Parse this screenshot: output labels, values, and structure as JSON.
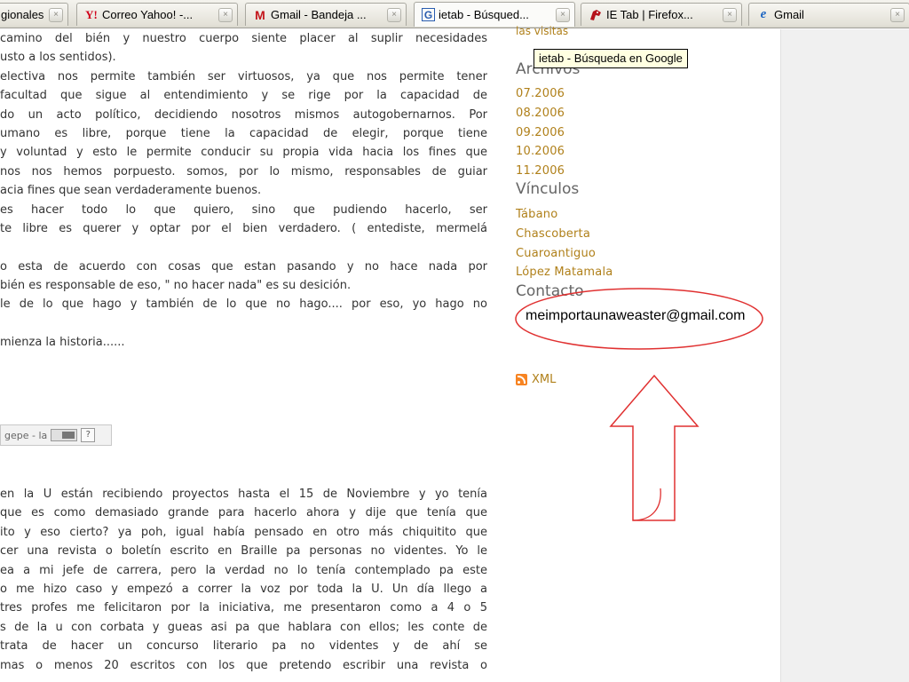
{
  "tabs": [
    {
      "label": "gionales",
      "icon": "tab-page-icon"
    },
    {
      "label": "Correo Yahoo! -...",
      "icon": "yahoo-icon"
    },
    {
      "label": "Gmail - Bandeja ...",
      "icon": "gmail-icon"
    },
    {
      "label": "ietab - Búsqued...",
      "icon": "google-icon",
      "active": true
    },
    {
      "label": "IE Tab | Firefox...",
      "icon": "ietab-icon"
    },
    {
      "label": "Gmail",
      "icon": "ie-icon"
    }
  ],
  "tab_close_glyph": "×",
  "tooltip": "ietab - Búsqueda en Google",
  "main": {
    "lines": [
      "camino del bién y nuestro cuerpo siente placer al suplir necesidades",
      "usto a los sentidos).",
      "electiva nos permite también ser virtuosos, ya que nos permite tener",
      "facultad que sigue al entendimiento y se rige por la capacidad de",
      "do un acto político, decidiendo nosotros mismos autogobernarnos. Por",
      "umano es libre, porque tiene la capacidad de elegir, porque tiene",
      "y voluntad y esto le permite conducir su propia vida hacia los fines que",
      "nos nos hemos porpuesto. somos, por lo mismo, responsables de guiar",
      "acia fines que sean verdaderamente buenos.",
      "es hacer todo lo que quiero, sino que pudiendo hacerlo, ser",
      "te libre es querer y optar por el bien verdadero. ( entediste, mermelá",
      "",
      "o esta de acuerdo con cosas que estan pasando y no hace nada por",
      "bién es responsable de eso, \" no hacer nada\" es su desición.",
      "le de lo que hago y también de lo que no hago.... por eso, yo hago no",
      "",
      "mienza la historia......"
    ],
    "widget_text": "gepe - la",
    "widget_help": "?",
    "lines2": [
      "en la U están recibiendo proyectos hasta el 15 de Noviembre y yo tenía",
      "que es como demasiado grande para hacerlo ahora y dije que tenía que",
      "ito y eso cierto? ya poh, igual había pensado en otro más chiquitito que",
      "cer una revista o boletín escrito en Braille pa personas no videntes. Yo le",
      "ea a mi jefe de carrera, pero la verdad no lo tenía contemplado pa este",
      "o me hizo caso y empezó a correr la voz por toda la U. Un día llego a",
      "tres profes me felicitaron por la iniciativa, me presentaron como a 4 o 5",
      "s de la u con corbata y gueas asi pa que hablara con ellos; les conte de",
      "trata de hacer un concurso literario pa no videntes y de ahí se",
      "mas o menos 20 escritos con los que pretendo escribir una revista o"
    ]
  },
  "sidebar": {
    "faint_top": "las visitas",
    "archive_heading": "Archivos",
    "archives": [
      "07.2006",
      "08.2006",
      "09.2006",
      "10.2006",
      "11.2006"
    ],
    "links_heading": "Vínculos",
    "links": [
      "Tábano",
      "Chascoberta",
      "Cuaroantiguo",
      "López Matamala"
    ],
    "contact_heading": "Contacto",
    "email": "meimportaunaweaster@gmail.com",
    "xml_label": "XML"
  },
  "colors": {
    "link": "#b0801a",
    "annotation": "#e03030",
    "heading": "#666666"
  }
}
